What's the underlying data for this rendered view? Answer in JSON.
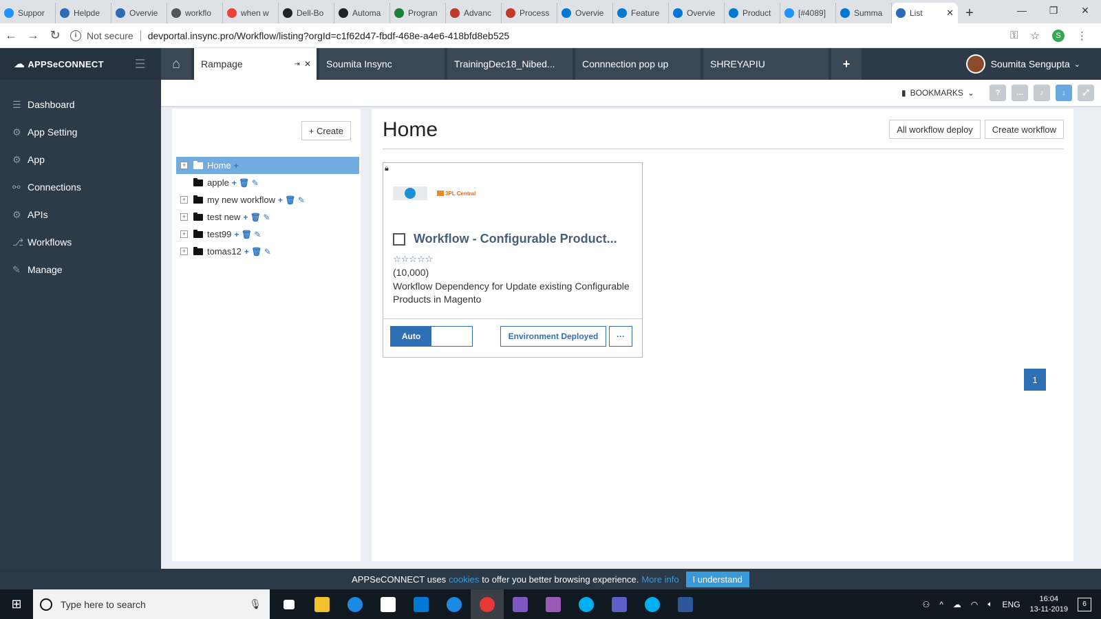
{
  "browser": {
    "tabs": [
      {
        "label": "Suppor",
        "color": "#1e90ff"
      },
      {
        "label": "Helpde",
        "color": "#2d6cb5"
      },
      {
        "label": "Overvie",
        "color": "#2d6cb5"
      },
      {
        "label": "workflo",
        "color": "#555555"
      },
      {
        "label": "when w",
        "color": "#ea4335"
      },
      {
        "label": "Dell-Bo",
        "color": "#222222"
      },
      {
        "label": "Automa",
        "color": "#222222"
      },
      {
        "label": "Progran",
        "color": "#1a7f37"
      },
      {
        "label": "Advanc",
        "color": "#c0392b"
      },
      {
        "label": "Process",
        "color": "#c0392b"
      },
      {
        "label": "Overvie",
        "color": "#0078d4"
      },
      {
        "label": "Feature",
        "color": "#0078d4"
      },
      {
        "label": "Overvie",
        "color": "#0078d4"
      },
      {
        "label": "Product",
        "color": "#0078d4"
      },
      {
        "label": "[#4089]",
        "color": "#1e90ff"
      },
      {
        "label": "Summa",
        "color": "#0078d4"
      }
    ],
    "active_tab": {
      "label": "List",
      "color": "#2d6cb5"
    },
    "new_tab": "+",
    "window_controls": [
      "—",
      "❐",
      "✕"
    ],
    "not_secure": "Not secure",
    "url": "devportal.insync.pro/Workflow/listing?orgId=c1f62d47-fbdf-468e-a4e6-418bfd8eb525",
    "profile_initial": "S"
  },
  "app": {
    "logo": "APPSeCONNECT",
    "sidebar": [
      {
        "label": "Dashboard",
        "icon": "☰"
      },
      {
        "label": "App Setting",
        "icon": "⚙"
      },
      {
        "label": "App",
        "icon": "⚙"
      },
      {
        "label": "Connections",
        "icon": "⚯"
      },
      {
        "label": "APIs",
        "icon": "⚙"
      },
      {
        "label": "Workflows",
        "icon": "⎇"
      },
      {
        "label": "Manage",
        "icon": "✎"
      }
    ],
    "tabs": [
      {
        "label": "Rampage"
      },
      {
        "label": "Soumita Insync"
      },
      {
        "label": "TrainingDec18_Nibed..."
      },
      {
        "label": "Connnection pop up"
      },
      {
        "label": "SHREYAPIU"
      }
    ],
    "user_name": "Soumita Sengupta",
    "bookmarks_label": "BOOKMARKS"
  },
  "tree": {
    "create_label": "+ Create",
    "nodes": [
      {
        "label": "Home",
        "expandable": true,
        "selected": true,
        "actions": "+"
      },
      {
        "label": "apple",
        "expandable": false,
        "selected": false,
        "actions": "+ 🗑 ✎"
      },
      {
        "label": "my new workflow",
        "expandable": true,
        "selected": false,
        "actions": "+ 🗑 ✎"
      },
      {
        "label": "test new",
        "expandable": true,
        "selected": false,
        "actions": "+ 🗑 ✎"
      },
      {
        "label": "test99",
        "expandable": true,
        "selected": false,
        "actions": "+ 🗑 ✎"
      },
      {
        "label": "tomas12",
        "expandable": true,
        "selected": false,
        "actions": "+ 🗑 ✎"
      }
    ]
  },
  "main": {
    "title": "Home",
    "all_deploy_label": "All workflow deploy",
    "create_workflow_label": "Create workflow",
    "card": {
      "logo2_text": "3PL Central",
      "title": "Workflow - Configurable Product...",
      "stars": "☆☆☆☆☆",
      "count": "(10,000)",
      "description": "Workflow Dependency for Update existing Configurable Products in Magento",
      "toggle_label": "Auto",
      "env_label": "Environment Deployed",
      "more_label": "···"
    },
    "page_number": "1"
  },
  "cookie": {
    "text1": "APPSeCONNECT uses",
    "link1": "cookies",
    "text2": "to offer you better browsing experience.",
    "link2": "More info",
    "button": "I understand"
  },
  "taskbar": {
    "search_placeholder": "Type here to search",
    "icons": [
      {
        "name": "task-view",
        "color": "#ffffff"
      },
      {
        "name": "file-explorer",
        "color": "#f2c12e"
      },
      {
        "name": "edge",
        "color": "#1e88e5"
      },
      {
        "name": "store",
        "color": "#ffffff"
      },
      {
        "name": "outlook",
        "color": "#0078d4"
      },
      {
        "name": "appseconnect",
        "color": "#1e88e5"
      },
      {
        "name": "chrome",
        "color": "#e53935"
      },
      {
        "name": "visual-studio",
        "color": "#7e57c2"
      },
      {
        "name": "app",
        "color": "#9b59b6"
      },
      {
        "name": "skype-business",
        "color": "#00aff0"
      },
      {
        "name": "teams",
        "color": "#5b5fc7"
      },
      {
        "name": "skype",
        "color": "#00aff0"
      },
      {
        "name": "word",
        "color": "#2b579a"
      }
    ],
    "lang": "ENG",
    "time": "16:04",
    "date": "13-11-2019",
    "notifications": "6"
  }
}
